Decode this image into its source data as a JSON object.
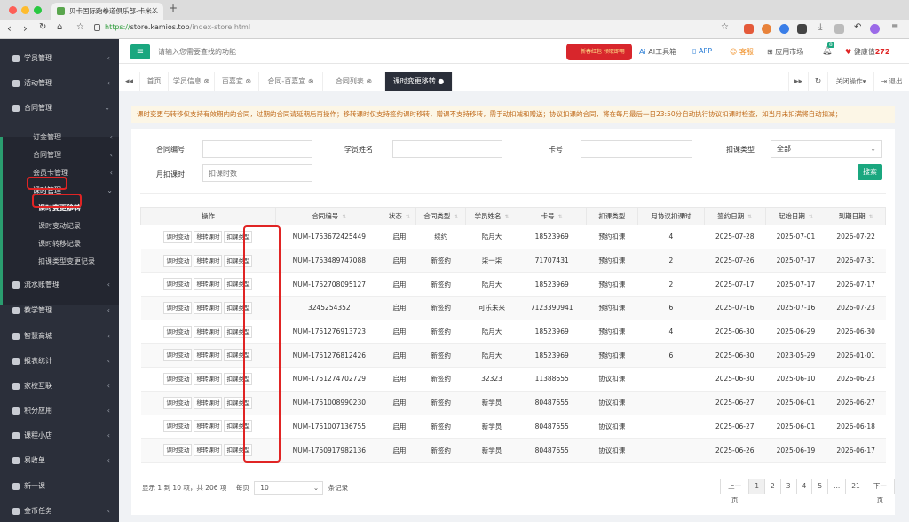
{
  "browser": {
    "tab_title": "贝卡国际跆拳道俱乐部-卡米…",
    "url_scheme": "https://",
    "url_host": "store.kamios.top",
    "url_path": "/index-store.html"
  },
  "sidebar": {
    "items": [
      {
        "label": "学员管理"
      },
      {
        "label": "活动管理"
      },
      {
        "label": "合同管理"
      },
      {
        "label": "订金管理"
      },
      {
        "label": "合同管理"
      },
      {
        "label": "会员卡管理"
      },
      {
        "label": "课时管理"
      },
      {
        "label": "课时变更移转"
      },
      {
        "label": "课时变动记录"
      },
      {
        "label": "课时转移记录"
      },
      {
        "label": "扣课类型变更记录"
      },
      {
        "label": "流水账管理"
      },
      {
        "label": "教学管理"
      },
      {
        "label": "智慧商城"
      },
      {
        "label": "报表统计"
      },
      {
        "label": "家校互联"
      },
      {
        "label": "积分应用"
      },
      {
        "label": "课程小店"
      },
      {
        "label": "易收单"
      },
      {
        "label": "新一课"
      },
      {
        "label": "金币任务"
      }
    ]
  },
  "header": {
    "search_placeholder": "请输入您需要查找的功能",
    "promo_label": "新春红包 领取即用",
    "ai_tools": "AI工具箱",
    "app": "APP",
    "service": "客服",
    "market": "应用市场",
    "bell_badge": "8",
    "health_label": "健康值",
    "health_value": "272"
  },
  "tabs": {
    "items": [
      "首页",
      "学员信息",
      "百嘉宜",
      "合同-百嘉宜",
      "合同列表",
      "课时变更移转"
    ],
    "close_ops": "关闭操作",
    "logout": "退出"
  },
  "notice": "课时变更与转移仅支持有效期内的合同，过期的合同请延期后再操作；移转课时仅支持签约课时移转，赠课不支持移转，需手动扣减和赠送；协议扣课的合同，将在每月最后一日23:50分自动执行协议扣课时检查，如当月未扣满将自动扣减；",
  "filters": {
    "contract_no_label": "合同编号",
    "student_name_label": "学员姓名",
    "card_no_label": "卡号",
    "deduct_type_label": "扣课类型",
    "deduct_type_value": "全部",
    "monthly_label": "月扣课时",
    "monthly_placeholder": "扣课时数",
    "search_button": "搜索"
  },
  "table": {
    "headers": [
      "操作",
      "合同编号",
      "状态",
      "合同类型",
      "学员姓名",
      "卡号",
      "扣课类型",
      "月协议扣课时",
      "签约日期",
      "起始日期",
      "到期日期"
    ],
    "op_labels": [
      "课时变动",
      "移转课时",
      "扣课类型"
    ],
    "rows": [
      {
        "contract": "NUM-1753672425449",
        "status": "启用",
        "type": "续约",
        "name": "陆月大",
        "card": "18523969",
        "deduct": "预约扣课",
        "monthly": "4",
        "sign": "2025-07-28",
        "start": "2025-07-01",
        "end": "2026-07-22"
      },
      {
        "contract": "NUM-1753489747088",
        "status": "启用",
        "type": "新签约",
        "name": "柒一柒",
        "card": "71707431",
        "deduct": "预约扣课",
        "monthly": "2",
        "sign": "2025-07-26",
        "start": "2025-07-17",
        "end": "2026-07-31"
      },
      {
        "contract": "NUM-1752708095127",
        "status": "启用",
        "type": "新签约",
        "name": "陆月大",
        "card": "18523969",
        "deduct": "预约扣课",
        "monthly": "2",
        "sign": "2025-07-17",
        "start": "2025-07-17",
        "end": "2026-07-17"
      },
      {
        "contract": "3245254352",
        "status": "启用",
        "type": "新签约",
        "name": "可乐未来",
        "card": "7123390941",
        "deduct": "预约扣课",
        "monthly": "6",
        "sign": "2025-07-16",
        "start": "2025-07-16",
        "end": "2026-07-23"
      },
      {
        "contract": "NUM-1751276913723",
        "status": "启用",
        "type": "新签约",
        "name": "陆月大",
        "card": "18523969",
        "deduct": "预约扣课",
        "monthly": "4",
        "sign": "2025-06-30",
        "start": "2025-06-29",
        "end": "2026-06-30"
      },
      {
        "contract": "NUM-1751276812426",
        "status": "启用",
        "type": "新签约",
        "name": "陆月大",
        "card": "18523969",
        "deduct": "预约扣课",
        "monthly": "6",
        "sign": "2025-06-30",
        "start": "2023-05-29",
        "end": "2026-01-01"
      },
      {
        "contract": "NUM-1751274702729",
        "status": "启用",
        "type": "新签约",
        "name": "32323",
        "card": "11388655",
        "deduct": "协议扣课",
        "monthly": "",
        "sign": "2025-06-30",
        "start": "2025-06-10",
        "end": "2026-06-23"
      },
      {
        "contract": "NUM-1751008990230",
        "status": "启用",
        "type": "新签约",
        "name": "新学员",
        "card": "80487655",
        "deduct": "协议扣课",
        "monthly": "",
        "sign": "2025-06-27",
        "start": "2025-06-01",
        "end": "2026-06-27"
      },
      {
        "contract": "NUM-1751007136755",
        "status": "启用",
        "type": "新签约",
        "name": "新学员",
        "card": "80487655",
        "deduct": "协议扣课",
        "monthly": "",
        "sign": "2025-06-27",
        "start": "2025-06-01",
        "end": "2026-06-18"
      },
      {
        "contract": "NUM-1750917982136",
        "status": "启用",
        "type": "新签约",
        "name": "新学员",
        "card": "80487655",
        "deduct": "协议扣课",
        "monthly": "",
        "sign": "2025-06-26",
        "start": "2025-06-19",
        "end": "2026-06-17"
      }
    ]
  },
  "footer": {
    "info": "显示 1 到 10 项，共 206 项",
    "per_page_label": "每页",
    "per_page_value": "10",
    "per_page_suffix": "条记录",
    "pager": [
      "上一页",
      "1",
      "2",
      "3",
      "4",
      "5",
      "...",
      "21",
      "下一页"
    ]
  },
  "colors": {
    "accent": "#1aa77f",
    "sidebar": "#2b2f3a",
    "highlight_box": "#e02424",
    "deduct_reserve": "#e02424",
    "deduct_agreement": "#2d7fd6"
  }
}
